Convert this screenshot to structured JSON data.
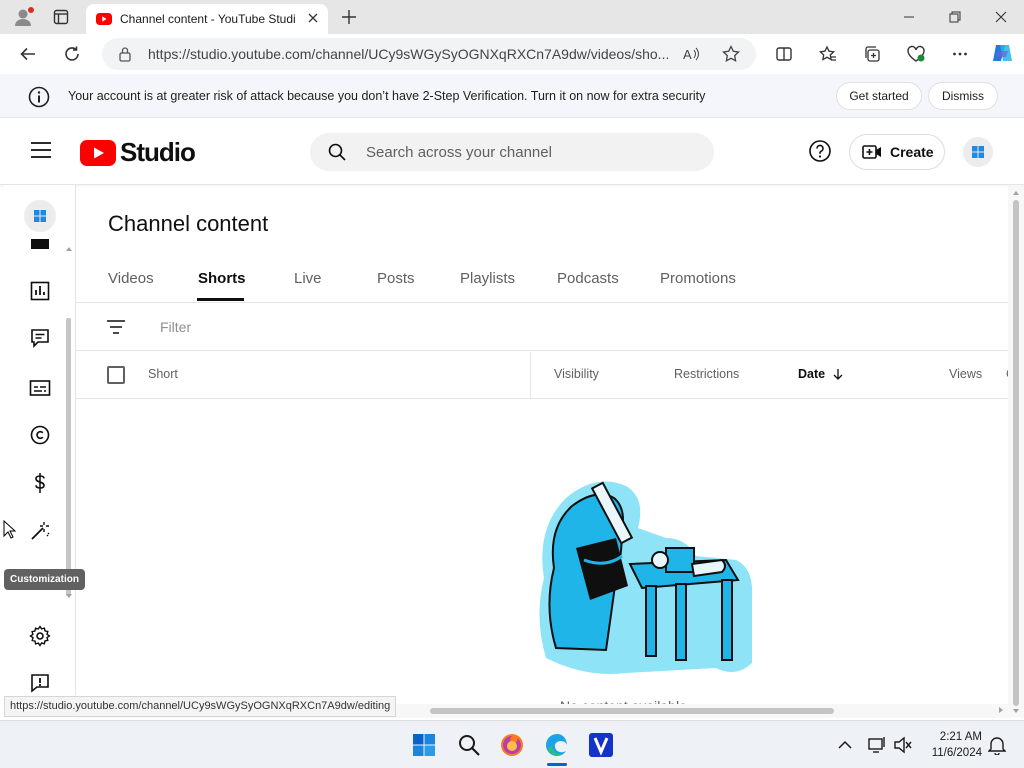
{
  "browser": {
    "tab_title": "Channel content - YouTube Studio",
    "url": "https://studio.youtube.com/channel/UCy9sWGySyOGNXqRXCn7A9dw/videos/sho...",
    "status_url": "https://studio.youtube.com/channel/UCy9sWGySyOGNXqRXCn7A9dw/editing"
  },
  "banner": {
    "message": "Your account is at greater risk of attack because you don’t have 2-Step Verification. Turn it on now for extra security",
    "get_started": "Get started",
    "dismiss": "Dismiss"
  },
  "header": {
    "logo_text": "Studio",
    "search_placeholder": "Search across your channel",
    "create_label": "Create"
  },
  "rail": {
    "tooltip": "Customization"
  },
  "main": {
    "title": "Channel content",
    "tabs": [
      "Videos",
      "Shorts",
      "Live",
      "Posts",
      "Playlists",
      "Podcasts",
      "Promotions"
    ],
    "active_tab": "Shorts",
    "filter_placeholder": "Filter",
    "columns": {
      "short": "Short",
      "visibility": "Visibility",
      "restrictions": "Restrictions",
      "date": "Date",
      "views": "Views",
      "comments_partial": "C"
    },
    "empty_text": "No content available"
  },
  "taskbar": {
    "time": "2:21 AM",
    "date": "11/6/2024"
  },
  "colors": {
    "youtube_red": "#ff0000",
    "edge_blue": "#0a63c9",
    "illustration_cyan": "#1fb5e8"
  }
}
